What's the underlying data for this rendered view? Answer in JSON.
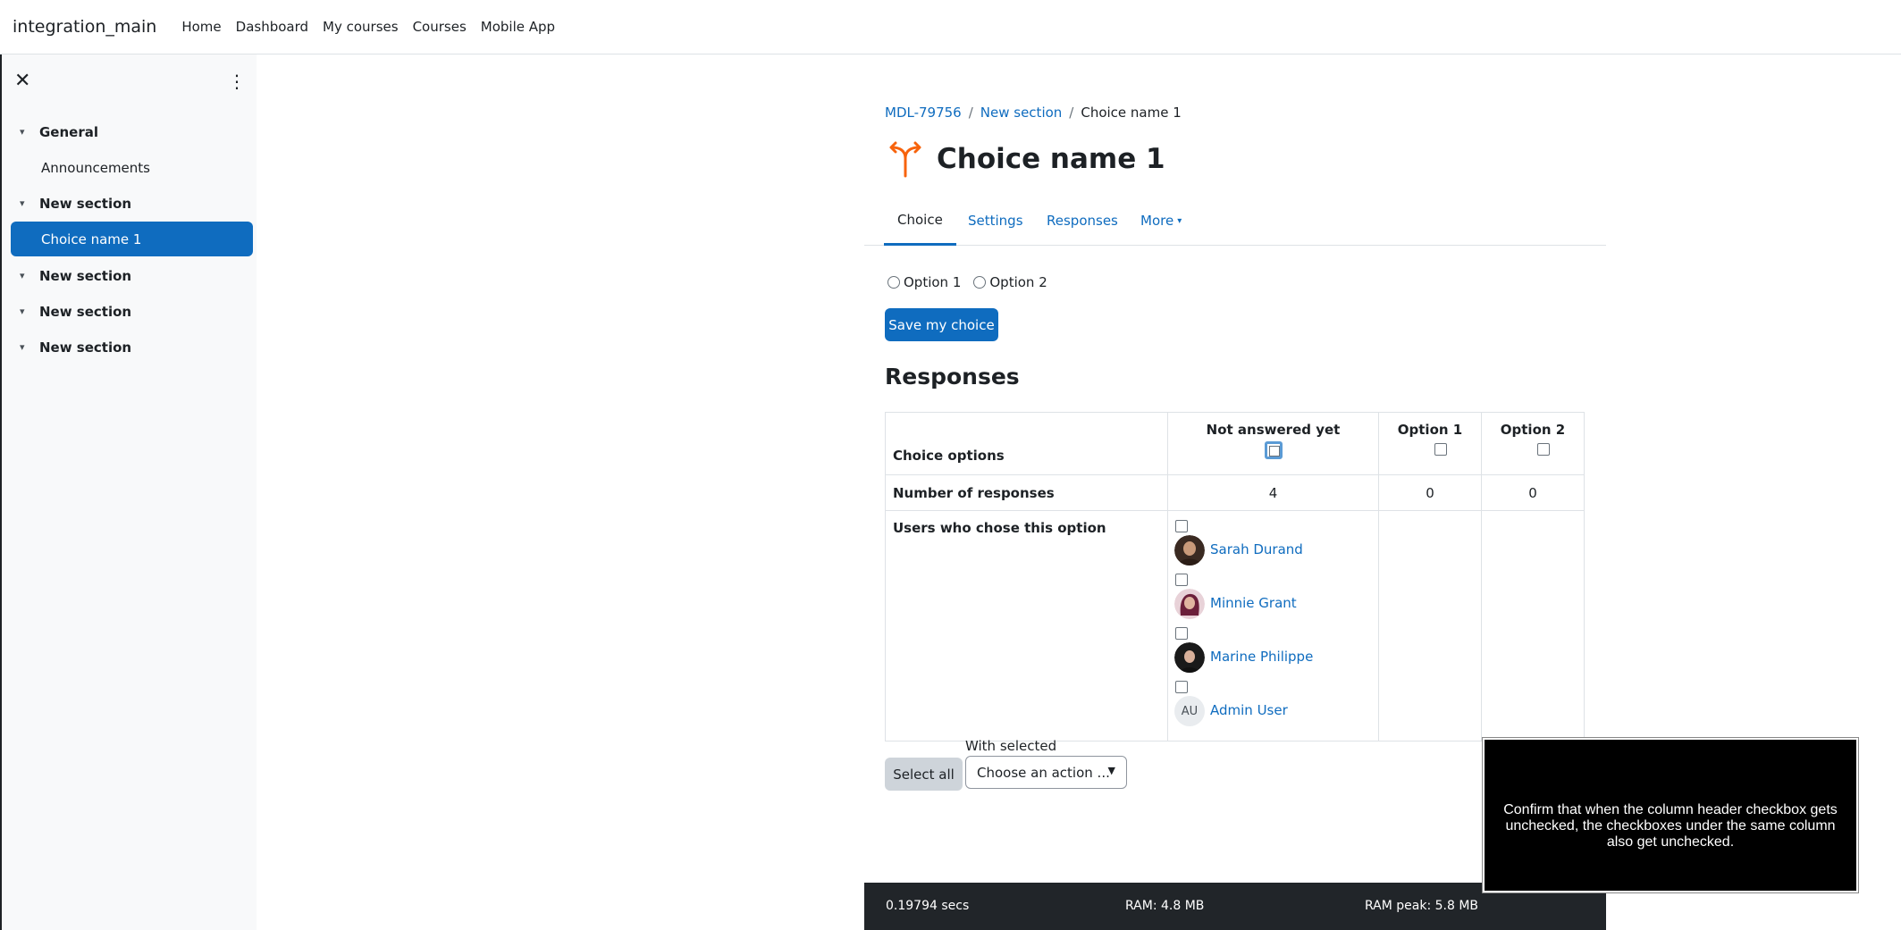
{
  "navbar": {
    "brand": "integration_main",
    "links": [
      "Home",
      "Dashboard",
      "My courses",
      "Courses",
      "Mobile App"
    ]
  },
  "drawer": {
    "items": [
      {
        "label": "General",
        "type": "section"
      },
      {
        "label": "Announcements",
        "type": "child"
      },
      {
        "label": "New section",
        "type": "section"
      },
      {
        "label": "Choice name 1",
        "type": "active"
      },
      {
        "label": "New section",
        "type": "section"
      },
      {
        "label": "New section",
        "type": "section"
      },
      {
        "label": "New section",
        "type": "section"
      }
    ]
  },
  "breadcrumb": {
    "items": [
      "MDL-79756",
      "New section",
      "Choice name 1"
    ],
    "separator": "/"
  },
  "page": {
    "title": "Choice name 1"
  },
  "tabs": [
    "Choice",
    "Settings",
    "Responses",
    "More"
  ],
  "choice_form": {
    "options": [
      "Option 1",
      "Option 2"
    ],
    "save_label": "Save my choice"
  },
  "responses": {
    "heading": "Responses",
    "row_labels": {
      "choice_options": "Choice options",
      "number": "Number of responses",
      "users": "Users who chose this option"
    },
    "columns": [
      {
        "label": "Not answered yet",
        "count": "4"
      },
      {
        "label": "Option 1",
        "count": "0"
      },
      {
        "label": "Option 2",
        "count": "0"
      }
    ],
    "users": [
      "Sarah Durand",
      "Minnie Grant",
      "Marine Philippe",
      "Admin User"
    ],
    "admin_initials": "AU"
  },
  "actions": {
    "select_all": "Select all",
    "with_selected": "With selected",
    "choose_action": "Choose an action ..."
  },
  "footer": {
    "time": "0.19794 secs",
    "ram": "RAM: 4.8 MB",
    "ram_peak": "RAM peak: 5.8 MB"
  },
  "overlay": {
    "text": "Confirm that when the column header checkbox gets unchecked, the checkboxes under the same column also get unchecked."
  },
  "colors": {
    "primary": "#0f6cbf",
    "icon_orange": "#f7630c",
    "footer_bg": "#212529"
  }
}
